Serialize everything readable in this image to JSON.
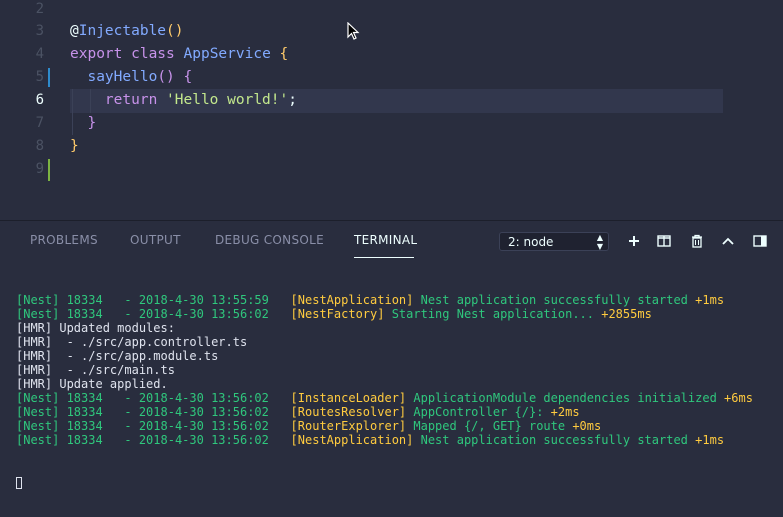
{
  "editor": {
    "lines": [
      {
        "num": "2",
        "tokens": []
      },
      {
        "num": "3",
        "tokens": [
          {
            "t": "@",
            "c": "plain"
          },
          {
            "t": "Injectable",
            "c": "fn"
          },
          {
            "t": "()",
            "c": "brace"
          }
        ]
      },
      {
        "num": "4",
        "tokens": [
          {
            "t": "export ",
            "c": "kw"
          },
          {
            "t": "class ",
            "c": "kw"
          },
          {
            "t": "AppService ",
            "c": "cls"
          },
          {
            "t": "{",
            "c": "brace"
          }
        ]
      },
      {
        "num": "5",
        "tokens": [
          {
            "t": "  ",
            "c": "plain"
          },
          {
            "t": "sayHello",
            "c": "fn"
          },
          {
            "t": "() ",
            "c": "brace2"
          },
          {
            "t": "{",
            "c": "brace2"
          }
        ]
      },
      {
        "num": "6",
        "tokens": [
          {
            "t": "    ",
            "c": "plain"
          },
          {
            "t": "return ",
            "c": "kw"
          },
          {
            "t": "'Hello world!'",
            "c": "str"
          },
          {
            "t": ";",
            "c": "plain"
          }
        ]
      },
      {
        "num": "7",
        "tokens": [
          {
            "t": "  ",
            "c": "plain"
          },
          {
            "t": "}",
            "c": "brace2"
          }
        ]
      },
      {
        "num": "8",
        "tokens": [
          {
            "t": "}",
            "c": "brace"
          }
        ]
      },
      {
        "num": "9",
        "tokens": []
      }
    ]
  },
  "panel": {
    "tabs": [
      "PROBLEMS",
      "OUTPUT",
      "DEBUG CONSOLE",
      "TERMINAL"
    ],
    "active_tab": "TERMINAL",
    "terminal_select": "2: node"
  },
  "terminal": {
    "lines": [
      [
        {
          "t": "[Nest] 18334   - 2018-4-30 13:55:59   ",
          "c": "green"
        },
        {
          "t": "[NestApplication] ",
          "c": "yellow"
        },
        {
          "t": "Nest application successfully started ",
          "c": "green"
        },
        {
          "t": "+1ms",
          "c": "yellow"
        }
      ],
      [
        {
          "t": "[Nest] 18334   - 2018-4-30 13:56:02   ",
          "c": "green"
        },
        {
          "t": "[NestFactory] ",
          "c": "yellow"
        },
        {
          "t": "Starting Nest application... ",
          "c": "green"
        },
        {
          "t": "+2855ms",
          "c": "yellow"
        }
      ],
      [
        {
          "t": "[HMR] Updated modules:",
          "c": "white"
        }
      ],
      [
        {
          "t": "[HMR]  - ./src/app.controller.ts",
          "c": "white"
        }
      ],
      [
        {
          "t": "[HMR]  - ./src/app.module.ts",
          "c": "white"
        }
      ],
      [
        {
          "t": "[HMR]  - ./src/main.ts",
          "c": "white"
        }
      ],
      [
        {
          "t": "[HMR] Update applied.",
          "c": "white"
        }
      ],
      [
        {
          "t": "[Nest] 18334   - 2018-4-30 13:56:02   ",
          "c": "green"
        },
        {
          "t": "[InstanceLoader] ",
          "c": "yellow"
        },
        {
          "t": "ApplicationModule dependencies initialized ",
          "c": "green"
        },
        {
          "t": "+6ms",
          "c": "yellow"
        }
      ],
      [
        {
          "t": "[Nest] 18334   - 2018-4-30 13:56:02   ",
          "c": "green"
        },
        {
          "t": "[RoutesResolver] ",
          "c": "yellow"
        },
        {
          "t": "AppController {/}: ",
          "c": "green"
        },
        {
          "t": "+2ms",
          "c": "yellow"
        }
      ],
      [
        {
          "t": "[Nest] 18334   - 2018-4-30 13:56:02   ",
          "c": "green"
        },
        {
          "t": "[RouterExplorer] ",
          "c": "yellow"
        },
        {
          "t": "Mapped {/, GET} route ",
          "c": "green"
        },
        {
          "t": "+0ms",
          "c": "yellow"
        }
      ],
      [
        {
          "t": "[Nest] 18334   - 2018-4-30 13:56:02   ",
          "c": "green"
        },
        {
          "t": "[NestApplication] ",
          "c": "yellow"
        },
        {
          "t": "Nest application successfully started ",
          "c": "green"
        },
        {
          "t": "+1ms",
          "c": "yellow"
        }
      ]
    ]
  },
  "icons": {
    "toolbar": [
      "plus-icon",
      "split-icon",
      "trash-icon",
      "chevron-up-icon",
      "panel-toggle-icon"
    ]
  }
}
